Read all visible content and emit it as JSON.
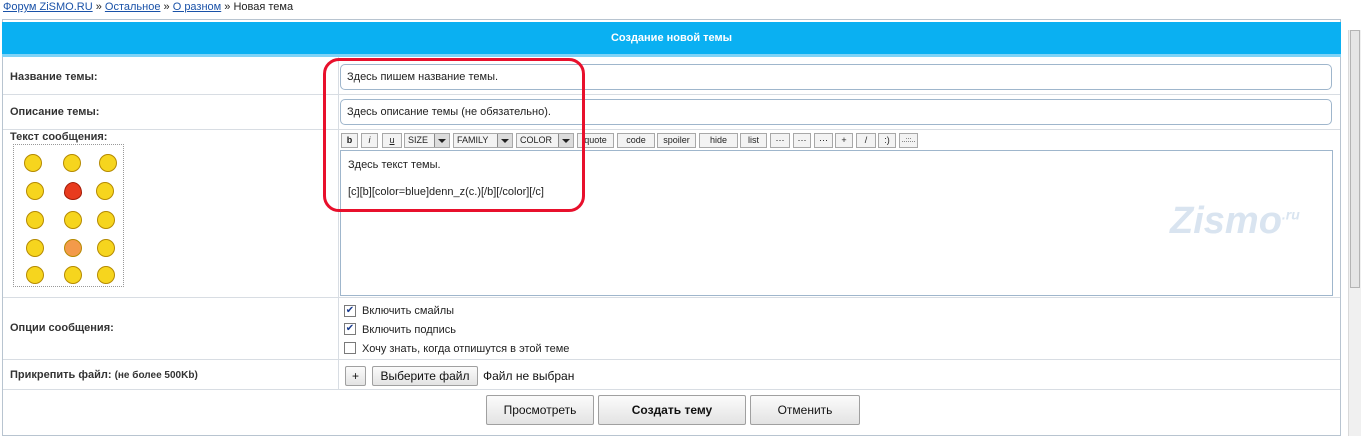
{
  "breadcrumb": {
    "link1": "Форум ZiSMO.RU",
    "sep": "»",
    "link2": "Остальное",
    "link3": "О разном",
    "current": "Новая тема"
  },
  "header": {
    "title": "Создание новой темы"
  },
  "fields": {
    "title_label": "Название темы:",
    "title_value": "Здесь пишем название темы.",
    "desc_label": "Описание темы:",
    "desc_value": "Здесь описание темы (не обязательно).",
    "message_label": "Текст сообщения:"
  },
  "toolbar": {
    "bold": "b",
    "italic": "i",
    "underline": "u",
    "size": "SIZE",
    "family": "FAMILY",
    "color": "COLOR",
    "quote": "quote",
    "code": "code",
    "spoiler": "spoiler",
    "hide": "hide",
    "list": "list",
    "b12": "⋯",
    "b13": "⋯",
    "b14": "⋯",
    "plus": "+",
    "slash": "/",
    "smiley": ":)",
    "dots": "..:::.."
  },
  "message": {
    "line1": "Здесь текст темы.",
    "line2": "[c][b][color=blue]denn_z(c.)[/b][/color][/c]"
  },
  "watermark": {
    "text": "Zismo",
    "suffix": ".ru"
  },
  "options": {
    "label": "Опции сообщения:",
    "items": [
      {
        "label": "Включить смайлы",
        "checked": true
      },
      {
        "label": "Включить подпись",
        "checked": true
      },
      {
        "label": "Хочу знать, когда отпишутся в этой теме",
        "checked": false
      }
    ]
  },
  "attach": {
    "label": "Прикрепить файл:",
    "hint": "(не более 500Kb)",
    "plus": "+",
    "choose": "Выберите файл",
    "status": "Файл не выбран"
  },
  "buttons": {
    "preview": "Просмотреть",
    "create": "Создать тему",
    "cancel": "Отменить"
  },
  "colors": {
    "header_bg": "#0ab0f2",
    "link": "#1a52a8",
    "highlight": "#e8102c"
  }
}
